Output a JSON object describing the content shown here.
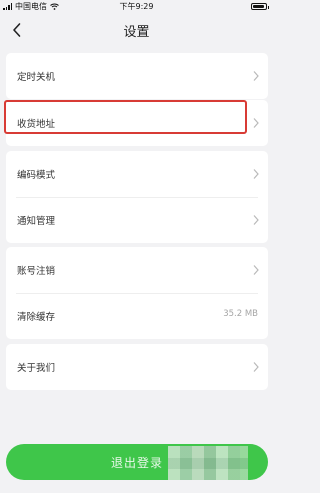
{
  "status_bar": {
    "carrier": "中国电信",
    "time": "下午9:29"
  },
  "header": {
    "title": "设置"
  },
  "groups": [
    {
      "items": [
        {
          "label": "定时关机"
        }
      ]
    },
    {
      "items": [
        {
          "label": "收货地址"
        }
      ]
    },
    {
      "items": [
        {
          "label": "编码模式"
        },
        {
          "label": "通知管理"
        }
      ]
    },
    {
      "items": [
        {
          "label": "账号注销"
        },
        {
          "label": "清除缓存",
          "value": "35.2 MB"
        }
      ]
    },
    {
      "items": [
        {
          "label": "关于我们"
        }
      ]
    }
  ],
  "logout": {
    "label": "退出登录"
  },
  "colors": {
    "accent": "#3fc64a",
    "highlight": "#d83b35",
    "background": "#f2f2f4"
  }
}
